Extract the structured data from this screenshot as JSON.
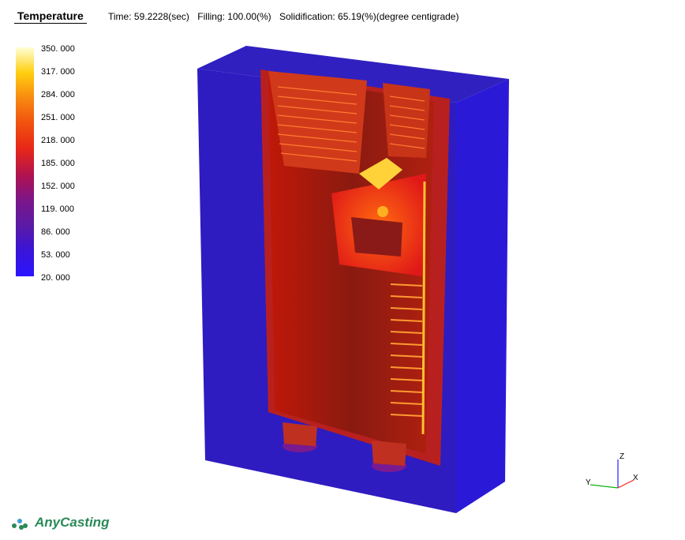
{
  "header": {
    "title": "Temperature",
    "time": "Time: 59.2228(sec)",
    "filling": "Filling: 100.00(%)",
    "solidification": "Solidification: 65.19(%)(degree centigrade)"
  },
  "legend": {
    "ticks": [
      "350. 000",
      "317. 000",
      "284. 000",
      "251. 000",
      "218. 000",
      "185. 000",
      "152. 000",
      "119. 000",
      "86. 000",
      "53. 000",
      "20. 000"
    ],
    "colors": [
      "#ffffd6",
      "#ffe600",
      "#f8a010",
      "#f56a0e",
      "#ee3610",
      "#e01818",
      "#a01460",
      "#7d1888",
      "#5a1ab0",
      "#3a14e0",
      "#2a14ff"
    ]
  },
  "view": {
    "mold_color": "#2a1fc8",
    "hot_color": "#e82818"
  },
  "axes": {
    "x": "X",
    "y": "Y",
    "z": "Z"
  },
  "brand": {
    "name": "AnyCasting"
  }
}
